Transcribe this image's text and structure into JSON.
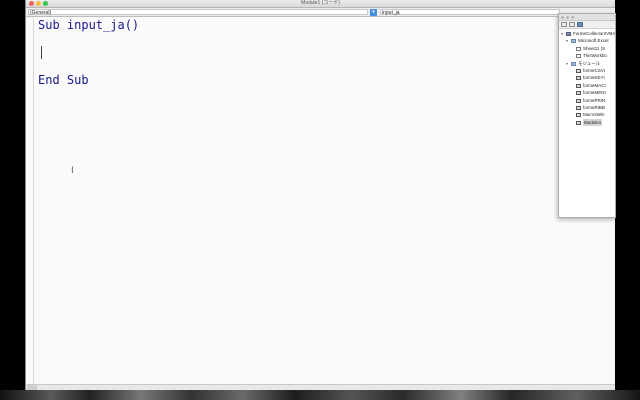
{
  "window": {
    "title": "Module1 (コード)"
  },
  "dropdowns": {
    "object": "(General)",
    "procedure": "input_ja"
  },
  "code": {
    "line1": "Sub input_ja()",
    "line3": "End Sub"
  },
  "project_panel": {
    "tree": [
      {
        "label": "FormeCollector2VBA",
        "indent": 0,
        "expanded": true,
        "icon": "project-icon"
      },
      {
        "label": "Microsoft Excel",
        "indent": 1,
        "expanded": true,
        "icon": "folder-icon"
      },
      {
        "label": "Sheet11 (S",
        "indent": 2,
        "expanded": null,
        "icon": "sheet-icon"
      },
      {
        "label": "ThisWorkbo",
        "indent": 2,
        "expanded": null,
        "icon": "sheet-icon"
      },
      {
        "label": "モジュール",
        "indent": 1,
        "expanded": true,
        "icon": "folder-icon"
      },
      {
        "label": "formeCSVI",
        "indent": 2,
        "expanded": null,
        "icon": "module-icon"
      },
      {
        "label": "formeKEYI",
        "indent": 2,
        "expanded": null,
        "icon": "module-icon"
      },
      {
        "label": "formeMACI",
        "indent": 2,
        "expanded": null,
        "icon": "module-icon"
      },
      {
        "label": "formeMENI",
        "indent": 2,
        "expanded": null,
        "icon": "module-icon"
      },
      {
        "label": "formePRIN",
        "indent": 2,
        "expanded": null,
        "icon": "module-icon"
      },
      {
        "label": "formeRIBB",
        "indent": 2,
        "expanded": null,
        "icon": "module-icon"
      },
      {
        "label": "MacVsWin",
        "indent": 2,
        "expanded": null,
        "icon": "module-icon"
      },
      {
        "label": "Module1",
        "indent": 2,
        "expanded": null,
        "icon": "module-icon",
        "selected": true
      }
    ]
  },
  "colors": {
    "keyword": "#1a1a8c",
    "close": "#fc605b",
    "minimize": "#fdbc40",
    "maximize": "#34c84a",
    "accent": "#4a8fe7"
  }
}
